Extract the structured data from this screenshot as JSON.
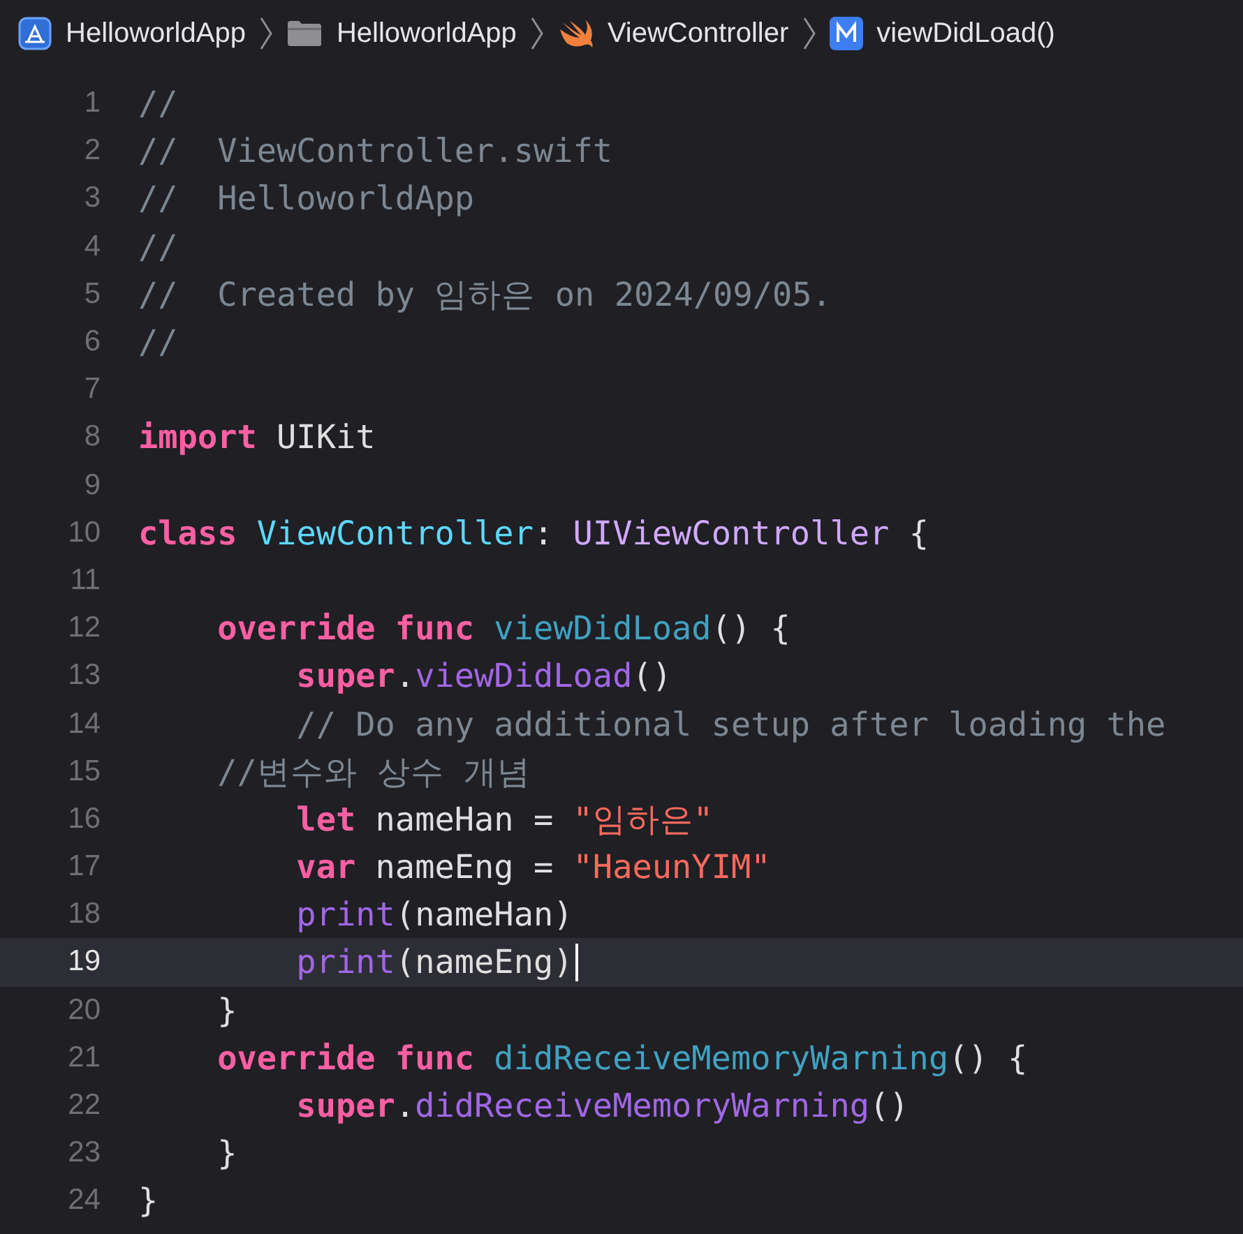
{
  "breadcrumb": [
    {
      "kind": "app",
      "label": "HelloworldApp"
    },
    {
      "kind": "folder",
      "label": "HelloworldApp"
    },
    {
      "kind": "swift",
      "label": "ViewController"
    },
    {
      "kind": "method",
      "label": "viewDidLoad()"
    }
  ],
  "lines": [
    {
      "number": "1",
      "current": false,
      "tokens": [
        {
          "kind": "comment",
          "text": "//"
        }
      ]
    },
    {
      "number": "2",
      "current": false,
      "tokens": [
        {
          "kind": "comment",
          "text": "//  ViewController.swift"
        }
      ]
    },
    {
      "number": "3",
      "current": false,
      "tokens": [
        {
          "kind": "comment",
          "text": "//  HelloworldApp"
        }
      ]
    },
    {
      "number": "4",
      "current": false,
      "tokens": [
        {
          "kind": "comment",
          "text": "//"
        }
      ]
    },
    {
      "number": "5",
      "current": false,
      "tokens": [
        {
          "kind": "comment",
          "text": "//  Created by 임하은 on 2024/09/05."
        }
      ]
    },
    {
      "number": "6",
      "current": false,
      "tokens": [
        {
          "kind": "comment",
          "text": "//"
        }
      ]
    },
    {
      "number": "7",
      "current": false
    },
    {
      "number": "8",
      "current": false,
      "tokens": [
        {
          "kind": "keyword",
          "text": "import"
        },
        {
          "kind": "plain",
          "text": " UIKit"
        }
      ]
    },
    {
      "number": "9",
      "current": false
    },
    {
      "number": "10",
      "current": false,
      "tokens": [
        {
          "kind": "keyword",
          "text": "class"
        },
        {
          "kind": "declaration",
          "text": " ViewController"
        },
        {
          "kind": "plain",
          "text": ":"
        },
        {
          "kind": "type",
          "text": " UIViewController"
        },
        {
          "kind": "plain",
          "text": " {"
        }
      ]
    },
    {
      "number": "11",
      "current": false
    },
    {
      "number": "12",
      "current": false,
      "tokens": [
        {
          "kind": "keyword",
          "text": "    override func"
        },
        {
          "kind": "function",
          "text": " viewDidLoad"
        },
        {
          "kind": "plain",
          "text": "() {"
        }
      ]
    },
    {
      "number": "13",
      "current": false,
      "tokens": [
        {
          "kind": "keyword",
          "text": "        super"
        },
        {
          "kind": "plain",
          "text": "."
        },
        {
          "kind": "call",
          "text": "viewDidLoad"
        },
        {
          "kind": "plain",
          "text": "()"
        }
      ]
    },
    {
      "number": "14",
      "current": false,
      "tokens": [
        {
          "kind": "comment",
          "text": "        // Do any additional setup after loading the"
        }
      ]
    },
    {
      "number": "15",
      "current": false,
      "tokens": [
        {
          "kind": "comment",
          "text": "    //변수와 상수 개념"
        }
      ]
    },
    {
      "number": "16",
      "current": false,
      "tokens": [
        {
          "kind": "keyword",
          "text": "        let"
        },
        {
          "kind": "plain",
          "text": " nameHan = "
        },
        {
          "kind": "string",
          "text": "\"임하은\""
        }
      ]
    },
    {
      "number": "17",
      "current": false,
      "tokens": [
        {
          "kind": "keyword",
          "text": "        var"
        },
        {
          "kind": "plain",
          "text": " nameEng = "
        },
        {
          "kind": "string",
          "text": "\"HaeunYIM\""
        }
      ]
    },
    {
      "number": "18",
      "current": false,
      "tokens": [
        {
          "kind": "call",
          "text": "        print"
        },
        {
          "kind": "plain",
          "text": "(nameHan)"
        }
      ]
    },
    {
      "number": "19",
      "current": true,
      "tokens": [
        {
          "kind": "call",
          "text": "        print"
        },
        {
          "kind": "plain",
          "text": "(nameEng)"
        }
      ]
    },
    {
      "number": "20",
      "current": false,
      "tokens": [
        {
          "kind": "plain",
          "text": "    }"
        }
      ]
    },
    {
      "number": "21",
      "current": false,
      "tokens": [
        {
          "kind": "keyword",
          "text": "    override func"
        },
        {
          "kind": "function",
          "text": " didReceiveMemoryWarning"
        },
        {
          "kind": "plain",
          "text": "() {"
        }
      ]
    },
    {
      "number": "22",
      "current": false,
      "tokens": [
        {
          "kind": "keyword",
          "text": "        super"
        },
        {
          "kind": "plain",
          "text": "."
        },
        {
          "kind": "call",
          "text": "didReceiveMemoryWarning"
        },
        {
          "kind": "plain",
          "text": "()"
        }
      ]
    },
    {
      "number": "23",
      "current": false,
      "tokens": [
        {
          "kind": "plain",
          "text": "    }"
        }
      ]
    },
    {
      "number": "24",
      "current": false,
      "tokens": [
        {
          "kind": "plain",
          "text": "}"
        }
      ]
    }
  ]
}
